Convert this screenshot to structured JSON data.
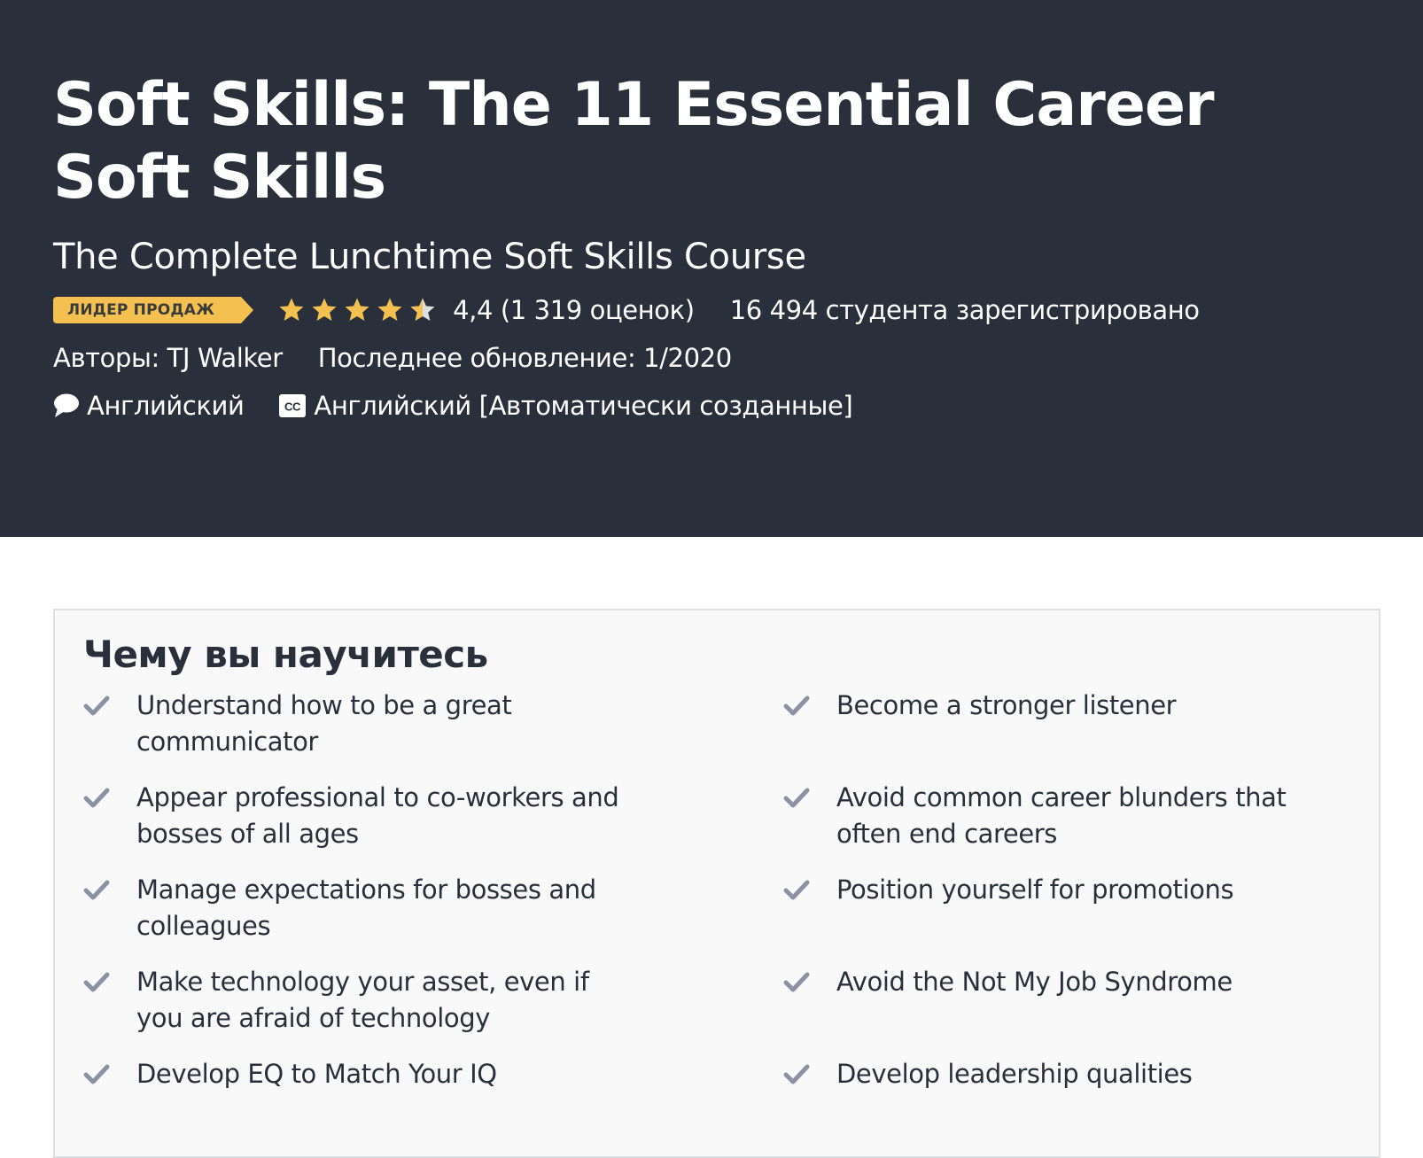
{
  "course": {
    "title": "Soft Skills: The 11 Essential Career Soft Skills",
    "subtitle": "The Complete Lunchtime Soft Skills Course",
    "badge": "ЛИДЕР ПРОДАЖ",
    "rating_value": 4.4,
    "rating_text": "4,4 (1 319 оценок)",
    "enrolled_text": "16 494 студента зарегистрировано",
    "authors_text": "Авторы: TJ Walker",
    "last_updated_text": "Последнее обновление: 1/2020",
    "language": "Английский",
    "captions": "Английский [Автоматически созданные]"
  },
  "learn": {
    "heading": "Чему вы научитесь",
    "items": [
      "Understand how to be a great communicator",
      "Become a stronger listener",
      "Appear professional to co-workers and bosses of all ages",
      "Avoid common career blunders that often end careers",
      "Manage expectations for bosses and colleagues",
      "Position yourself for promotions",
      "Make technology your asset, even if you are afraid of technology",
      "Avoid the Not My Job Syndrome",
      "Develop EQ to Match Your IQ",
      "Develop leadership qualities"
    ]
  },
  "colors": {
    "hero_bg": "#29303b",
    "badge_bg": "#f4c150",
    "star": "#f4c150",
    "star_empty": "#dedfe0",
    "check": "#8a92a3",
    "panel_bg": "#f9f9f9",
    "panel_border": "#dedfe0"
  },
  "icons": {
    "star": "star-icon",
    "language": "speech-bubble-icon",
    "captions": "closed-captions-icon",
    "check": "check-icon"
  }
}
